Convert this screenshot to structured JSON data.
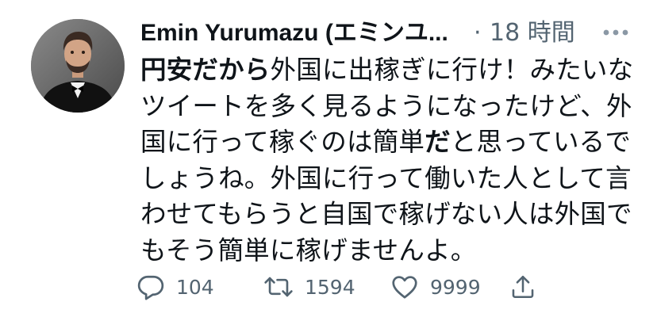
{
  "tweet": {
    "author_name": "Emin Yurumazu (エミンユ...",
    "separator": "·",
    "time": "18 時間",
    "lines": [
      [
        {
          "text": "円安だから",
          "bold": true
        },
        {
          "text": "外国に出稼ぎに行け！みたいな",
          "bold": false
        }
      ],
      [
        {
          "text": "ツイートを多く見るようになったけど、外",
          "bold": false
        }
      ],
      [
        {
          "text": "国に行って稼ぐのは簡単",
          "bold": false
        },
        {
          "text": "だ",
          "bold": true
        },
        {
          "text": "と思っているで",
          "bold": false
        }
      ],
      [
        {
          "text": "しょうね。外国に行って働いた人として言",
          "bold": false
        }
      ],
      [
        {
          "text": "わせてもらうと自国で稼げない人は外国で",
          "bold": false
        }
      ],
      [
        {
          "text": "もそう簡単に稼げませんよ。",
          "bold": false
        }
      ]
    ],
    "actions": {
      "reply_count": "104",
      "retweet_count": "1594",
      "like_count": "9999"
    }
  },
  "icons": {
    "more": "more-horizontal-icon",
    "reply": "reply-bubble-icon",
    "retweet": "retweet-icon",
    "like": "heart-icon",
    "share": "share-icon"
  },
  "colors": {
    "text_primary": "#0f1419",
    "text_secondary": "#536471",
    "background": "#ffffff"
  }
}
